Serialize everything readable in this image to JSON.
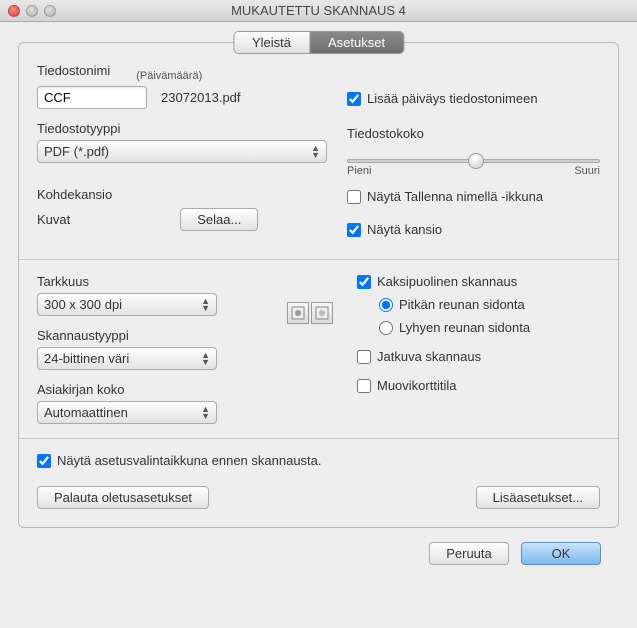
{
  "window": {
    "title": "MUKAUTETTU SKANNAUS 4"
  },
  "tabs": {
    "general": "Yleistä",
    "settings": "Asetukset"
  },
  "file": {
    "name_label": "Tiedostonimi",
    "date_label": "(Päivämäärä)",
    "name_value": "CCF",
    "date_value": "23072013.pdf",
    "type_label": "Tiedostotyyppi",
    "type_value": "PDF (*.pdf)"
  },
  "right1": {
    "add_date": "Lisää päiväys tiedostonimeen",
    "filesize_label": "Tiedostokoko",
    "small": "Pieni",
    "large": "Suuri",
    "show_saveas": "Näytä Tallenna nimellä -ikkuna",
    "show_folder": "Näytä kansio"
  },
  "dest": {
    "folder_label": "Kohdekansio",
    "images_label": "Kuvat",
    "browse": "Selaa..."
  },
  "scan": {
    "resolution_label": "Tarkkuus",
    "resolution_value": "300 x 300 dpi",
    "scantype_label": "Skannaustyyppi",
    "scantype_value": "24-bittinen väri",
    "docsize_label": "Asiakirjan koko",
    "docsize_value": "Automaattinen"
  },
  "right2": {
    "duplex": "Kaksipuolinen skannaus",
    "long_edge": "Pitkän reunan sidonta",
    "short_edge": "Lyhyen reunan sidonta",
    "continuous": "Jatkuva skannaus",
    "plastic": "Muovikorttitila"
  },
  "footer": {
    "show_settings": "Näytä asetusvalintaikkuna ennen skannausta.",
    "restore": "Palauta oletusasetukset",
    "advanced": "Lisäasetukset..."
  },
  "buttons": {
    "cancel": "Peruuta",
    "ok": "OK"
  }
}
